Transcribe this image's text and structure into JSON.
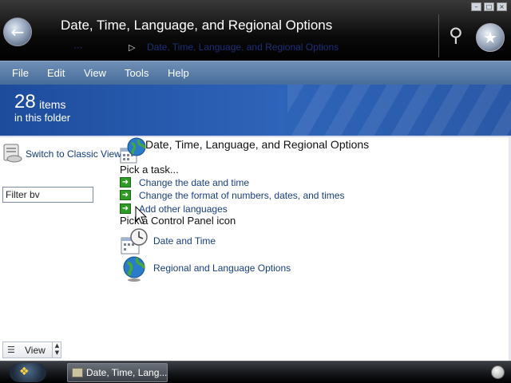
{
  "window": {
    "title": "Date, Time, Language, and Regional Options",
    "breadcrumb_path": "Date, Time, Language, and Regional Options"
  },
  "menu": [
    "File",
    "Edit",
    "View",
    "Tools",
    "Help"
  ],
  "banner": {
    "count": "28",
    "count_unit": "items",
    "subtitle": "in this folder"
  },
  "sidebar": {
    "classic_view_label": "Switch to Classic View",
    "filter_value": "Filter bv",
    "view_label": "View"
  },
  "category": {
    "title": "Date, Time, Language, and Regional Options",
    "pick_task": "Pick a task...",
    "tasks": [
      "Change the date and time",
      "Change the format of numbers, dates, and times",
      "Add other languages"
    ],
    "pick_icon": "Pick a Control Panel icon",
    "icons": [
      {
        "label": "Date and Time",
        "icon": "clock-calendar-icon"
      },
      {
        "label": "Regional and Language Options",
        "icon": "globe-icon"
      }
    ]
  },
  "taskbar": {
    "window_item": "Date, Time, Lang..."
  },
  "colors": {
    "menu_bar": "#5a7dab",
    "banner": "#2a5cad",
    "link": "#173e82",
    "task_arrow": "#2f9a26"
  }
}
